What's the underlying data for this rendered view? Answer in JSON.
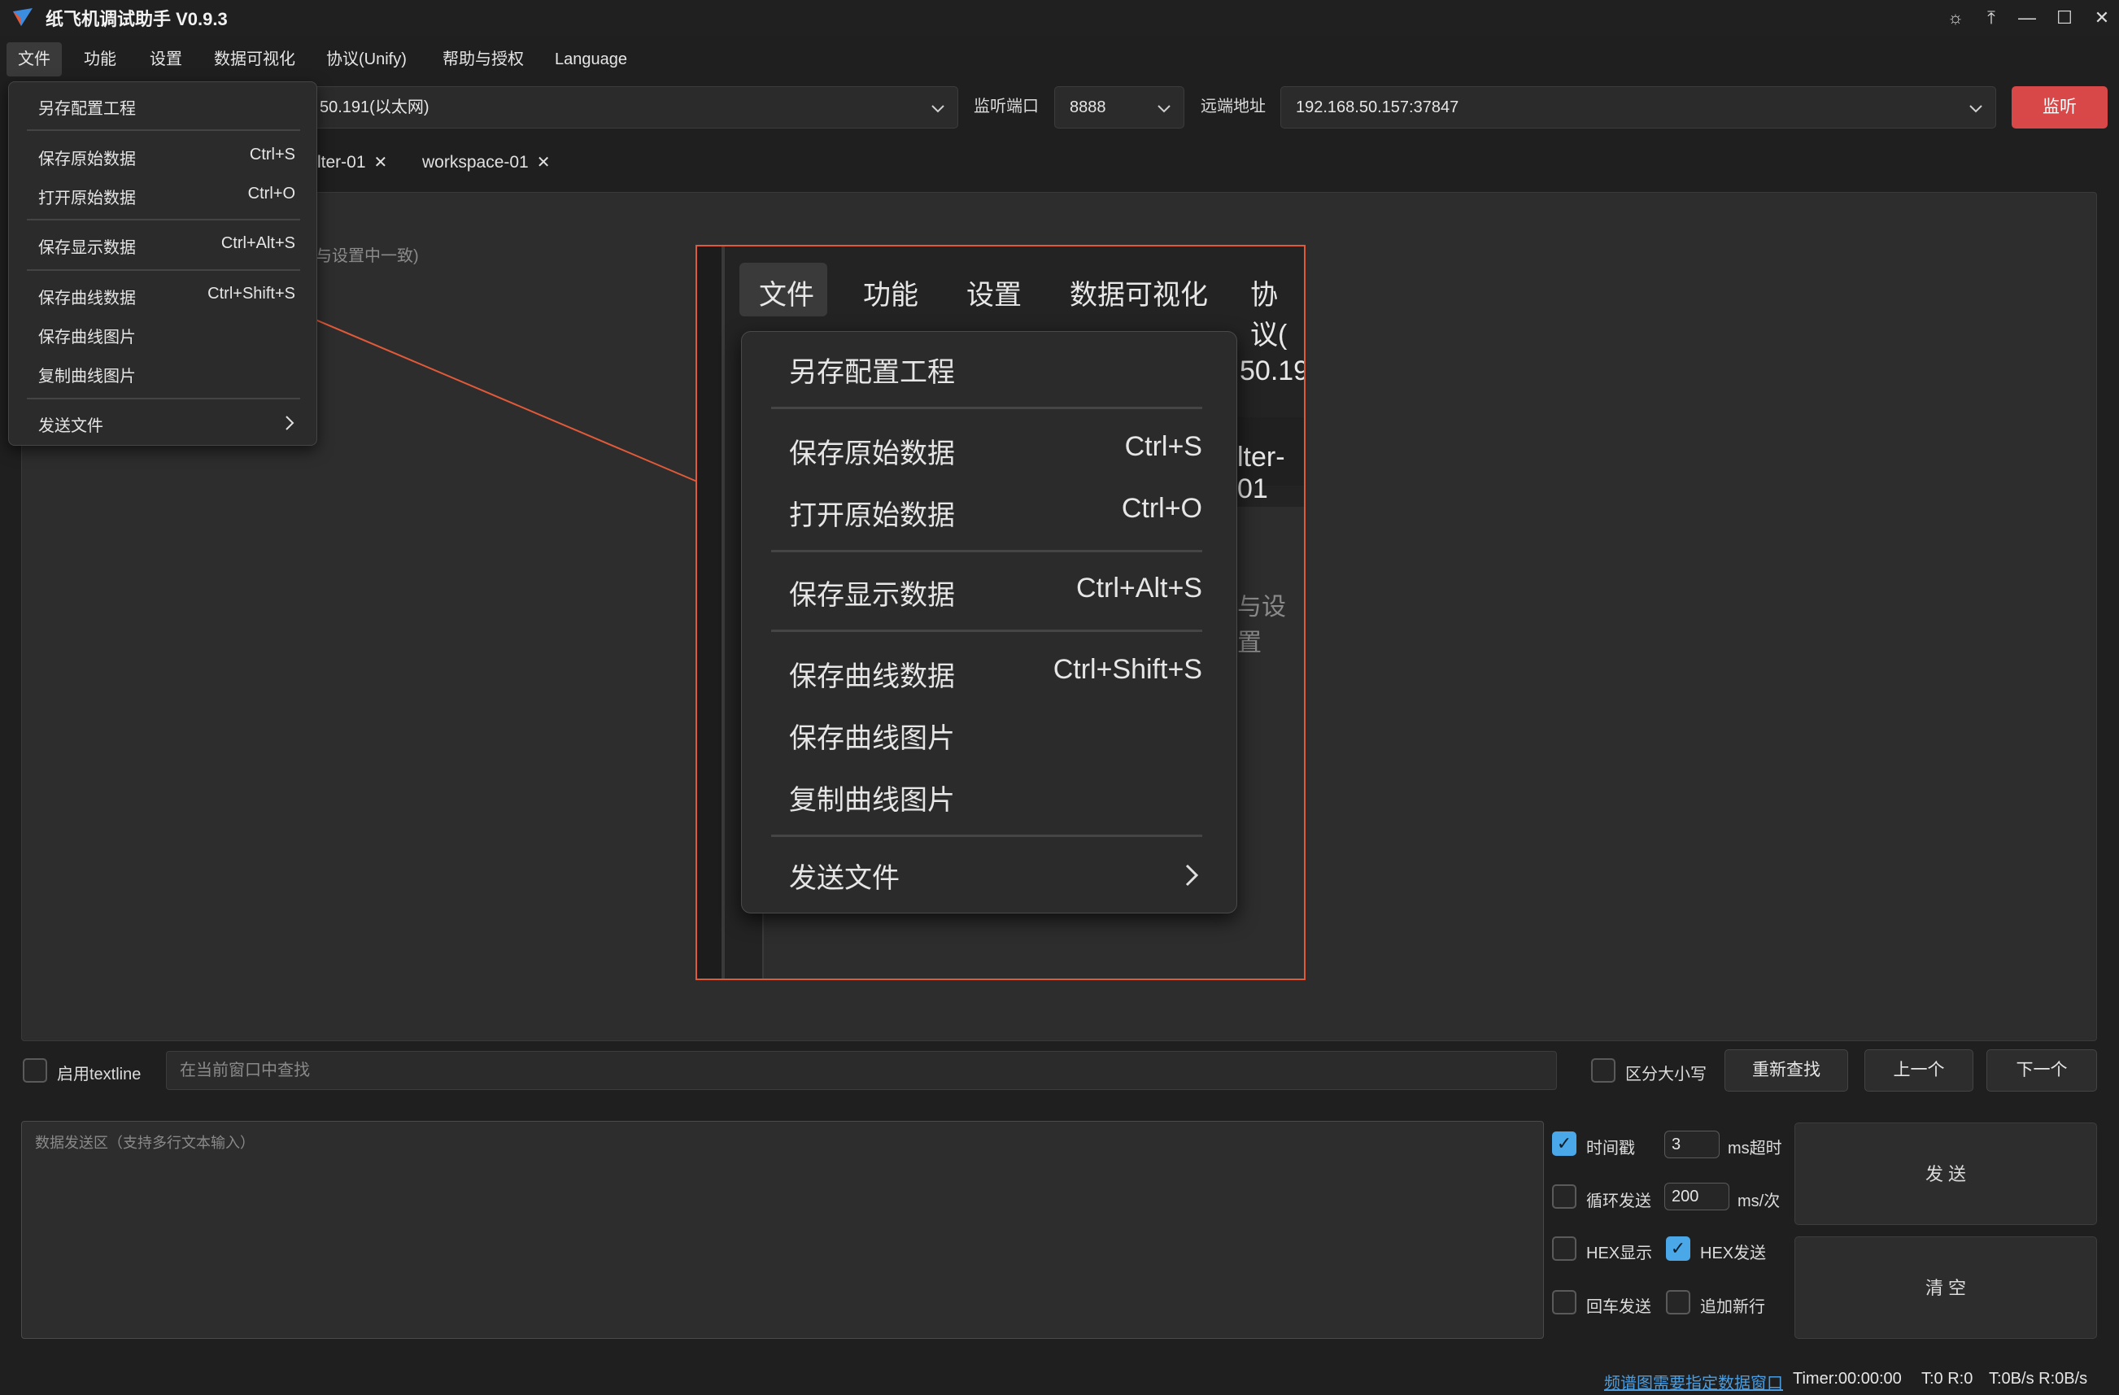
{
  "app": {
    "title": "纸飞机调试助手 V0.9.3"
  },
  "window_controls": {
    "theme": "☼",
    "pin": "⤒",
    "minimize": "—",
    "maximize": "☐",
    "close": "✕"
  },
  "menubar": [
    "文件",
    "功能",
    "设置",
    "数据可视化",
    "协议(Unify)",
    "帮助与授权",
    "Language"
  ],
  "connection": {
    "local_value": "50.191(以太网)",
    "port_label": "监听端口",
    "port_value": "8888",
    "remote_label": "远端地址",
    "remote_value": "192.168.50.157:37847",
    "listen_button": "监听"
  },
  "tabs": [
    {
      "label": "lter-01",
      "close": "✕"
    },
    {
      "label": "workspace-01",
      "close": "✕"
    }
  ],
  "main": {
    "hint_fragment": "与设置中一致)"
  },
  "file_menu": {
    "items": [
      {
        "label": "另存配置工程",
        "shortcut": ""
      },
      {
        "label": "保存原始数据",
        "shortcut": "Ctrl+S"
      },
      {
        "label": "打开原始数据",
        "shortcut": "Ctrl+O"
      },
      {
        "label": "保存显示数据",
        "shortcut": "Ctrl+Alt+S"
      },
      {
        "label": "保存曲线数据",
        "shortcut": "Ctrl+Shift+S"
      },
      {
        "label": "保存曲线图片",
        "shortcut": ""
      },
      {
        "label": "复制曲线图片",
        "shortcut": ""
      },
      {
        "label": "发送文件",
        "shortcut": ""
      }
    ],
    "submenu_arrow": "›"
  },
  "zoom": {
    "menubar": [
      "文件",
      "功能",
      "设置",
      "数据可视化",
      "协议("
    ],
    "bg_fragments": [
      "50.19",
      "lter-01",
      "与设置"
    ]
  },
  "search": {
    "textline_label": "启用textline",
    "placeholder": "在当前窗口中查找",
    "case_label": "区分大小写",
    "research_button": "重新查找",
    "prev_button": "上一个",
    "next_button": "下一个"
  },
  "send": {
    "placeholder": "数据发送区（支持多行文本输入）",
    "timestamp_label": "时间戳",
    "timeout_value": "3",
    "timeout_unit": "ms超时",
    "loop_label": "循环发送",
    "loop_value": "200",
    "loop_unit": "ms/次",
    "hex_show_label": "HEX显示",
    "hex_send_label": "HEX发送",
    "enter_send_label": "回车发送",
    "append_newline_label": "追加新行",
    "send_button": "发 送",
    "clear_button": "清 空",
    "checkmark": "✓"
  },
  "status": {
    "link": "频谱图需要指定数据窗口",
    "timer": "Timer:00:00:00",
    "counts": "T:0 R:0",
    "rates": "T:0B/s R:0B/s"
  }
}
